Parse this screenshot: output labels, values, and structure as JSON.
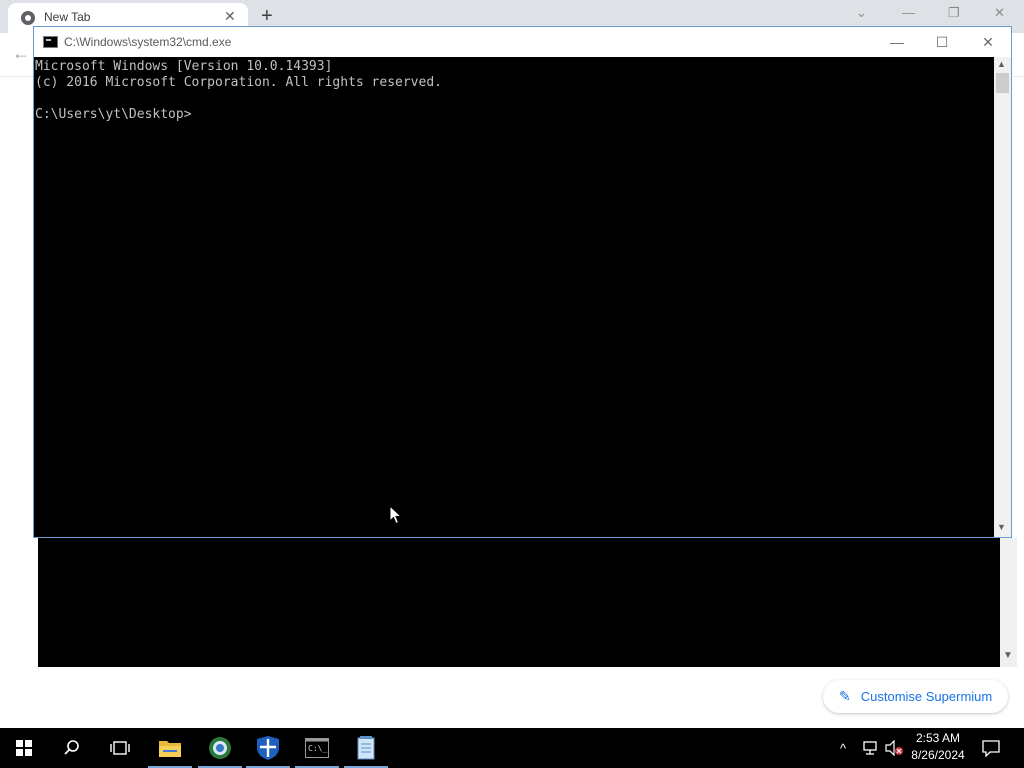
{
  "browser": {
    "tab_title": "New Tab",
    "tab_close": "✕",
    "new_tab": "+",
    "window_controls": {
      "collapse": "⌄",
      "minimize": "—",
      "restore": "❐",
      "close": "✕"
    },
    "back": "←",
    "customise_label": "Customise Supermium",
    "customise_icon": "pencil-icon"
  },
  "cmd": {
    "title": "C:\\Windows\\system32\\cmd.exe",
    "controls": {
      "minimize": "—",
      "maximize": "☐",
      "close": "✕"
    },
    "lines": [
      "Microsoft Windows [Version 10.0.14393]",
      "(c) 2016 Microsoft Corporation. All rights reserved.",
      "",
      "C:\\Users\\yt\\Desktop>"
    ]
  },
  "taskbar": {
    "items": [
      "windows-start-icon",
      "search-icon",
      "task-view-icon",
      "file-explorer-icon",
      "browser-icon",
      "security-shield-icon",
      "cmd-icon",
      "notepad-icon"
    ],
    "tray_chevron": "^",
    "clock_time": "2:53 AM",
    "clock_date": "8/26/2024"
  },
  "colors": {
    "console_bg": "#000000",
    "console_text": "#c0c0c0",
    "taskbar_bg": "#000000",
    "accent": "#1a73e8"
  }
}
